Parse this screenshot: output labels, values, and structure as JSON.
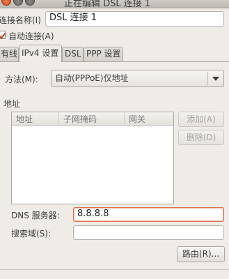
{
  "window": {
    "title": "正在编辑 DSL 连接 1"
  },
  "connection": {
    "name_label": "连接名称(I)",
    "name_value": "DSL 连接 1",
    "auto_connect_label": "自动连接(A)",
    "auto_connect_checked": true
  },
  "tabs": [
    {
      "label": "有线"
    },
    {
      "label": "IPv4 设置",
      "active": true
    },
    {
      "label": "DSL"
    },
    {
      "label": "PPP 设置"
    }
  ],
  "ipv4": {
    "method_label": "方法(M):",
    "method_value": "自动(PPPoE)仅地址",
    "addresses_section": "地址",
    "columns": [
      "地址",
      "子网掩码",
      "网关"
    ],
    "add_button": "添加(A)",
    "delete_button": "删除(D)",
    "dns_label": "DNS 服务器:",
    "dns_value": "8.8.8.8",
    "search_domains_label": "搜索域(S):",
    "search_domains_value": "",
    "routes_button": "路由(R)..."
  },
  "colors": {
    "focus_border": "#e07046",
    "check_mark": "#c8401a"
  }
}
